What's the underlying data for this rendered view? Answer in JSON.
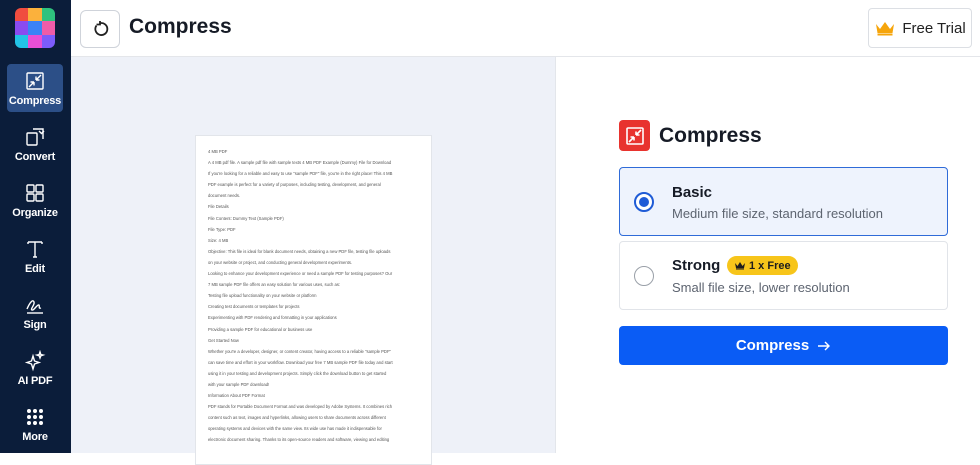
{
  "sidebar": {
    "logo_colors": [
      "#f04d3f",
      "#fbb13c",
      "#2ec27e",
      "#8a4bf0",
      "#3b82f6",
      "#ef5ca8",
      "#22c3e6",
      "#e84fd6",
      "#7c5cfc"
    ],
    "items": [
      {
        "label": "Compress",
        "icon": "compress-icon",
        "active": true
      },
      {
        "label": "Convert",
        "icon": "convert-icon",
        "active": false
      },
      {
        "label": "Organize",
        "icon": "organize-icon",
        "active": false
      },
      {
        "label": "Edit",
        "icon": "edit-icon",
        "active": false
      },
      {
        "label": "Sign",
        "icon": "sign-icon",
        "active": false
      },
      {
        "label": "AI PDF",
        "icon": "ai-sparkle-icon",
        "active": false
      },
      {
        "label": "More",
        "icon": "more-grid-icon",
        "active": false
      }
    ]
  },
  "header": {
    "title": "Compress",
    "back_icon": "undo-icon",
    "trial_label": "Free Trial",
    "trial_icon": "crown-icon"
  },
  "preview": {
    "lines": [
      "4 MB PDF",
      "A 4 MB pdf file. A sample pdf file with sample texts 4 MB PDF Example (Dummy) File for Download",
      "If you're looking for a reliable and easy to use \"sample PDF\" file, you're in the right place! This 4 MB",
      "PDF example is perfect for a variety of purposes, including testing, development, and general",
      "document needs.",
      "File Details",
      "File Content: Dummy Text (Sample PDF)",
      "File Type: PDF",
      "Size: 4 MB",
      "Objective: This file is ideal for blank document needs, obtaining a new PDF file, testing file uploads",
      "on your website or project, and conducting general development experiments.",
      "Looking to enhance your development experience or need a sample PDF for testing purposes? Our",
      "7 MB sample PDF file offers an easy solution for various uses, such as:",
      "Testing file upload functionality on your website or platform",
      "Creating test documents or templates for projects",
      "Experimenting with PDF rendering and formatting in your applications",
      "Providing a sample PDF for educational or business use",
      "Get Started Now",
      "Whether you're a developer, designer, or content creator, having access to a reliable \"sample PDF\"",
      "can save time and effort in your workflow. Download your free 7 MB sample PDF file today and start",
      "using it in your testing and development projects. Simply click the download button to get started",
      "with your sample PDF download!",
      "Information About PDF Format",
      "PDF stands for Portable Document Format and was developed by Adobe Systems. It combines rich",
      "content such as text, images and hyperlinks, allowing users to share documents across different",
      "operating systems and devices with the same view. Its wide use has made it indispensable for",
      "electronic document sharing. Thanks to its open-source readers and software, viewing and editing"
    ]
  },
  "panel": {
    "title": "Compress",
    "title_icon": "compress-icon",
    "options": [
      {
        "name": "Basic",
        "desc": "Medium file size, standard resolution",
        "selected": true
      },
      {
        "name": "Strong",
        "desc": "Small file size, lower resolution",
        "selected": false,
        "badge": "1 x Free",
        "badge_icon": "crown-icon"
      }
    ],
    "button_label": "Compress",
    "button_icon": "arrow-right-icon"
  },
  "colors": {
    "sidebar_bg": "#0b1d3a",
    "sidebar_active": "#2c4f87",
    "accent": "#0a5cf5",
    "compress_red": "#e8332e",
    "badge_gold": "#f7c51a"
  }
}
